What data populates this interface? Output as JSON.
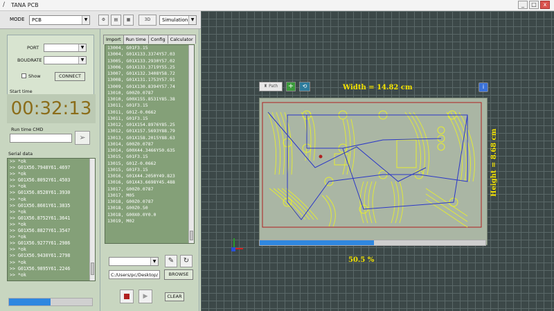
{
  "window": {
    "title": "TANA PCB",
    "controls": [
      "_",
      "□",
      "x"
    ]
  },
  "toolbar": {
    "mode_label": "MODE",
    "mode_value": "PCB",
    "run_mode_value": "Simulation",
    "btn_3d": "3D"
  },
  "connection": {
    "port_label": "PORT",
    "port_value": "",
    "baudrate_label": "BOUDRATE",
    "baudrate_value": "",
    "show_label": "Show",
    "connect_label": "CONNECT"
  },
  "start_time": {
    "label": "Start time",
    "value": "00:32:13"
  },
  "run_time_cmd": {
    "label": "Run time CMD",
    "value": ""
  },
  "serial": {
    "label": "Serial data",
    "lines": [
      ">> *ok",
      ">> G01X56.7948Y61.4697",
      ">> *ok",
      ">> G01X56.8092Y61.4503",
      ">> *ok",
      ">> G01X56.8528Y61.3930",
      ">> *ok",
      ">> G01X56.8601Y61.3835",
      ">> *ok",
      ">> G01X56.8752Y61.3641",
      ">> *ok",
      ">> G01X56.8827Y61.3547",
      ">> *ok",
      ">> G01X56.9277Y61.2986",
      ">> *ok",
      ">> G01X56.9430Y61.2798",
      ">> *ok",
      ">> G01X56.9895Y61.2246",
      ">> *ok"
    ],
    "progress": 0.5
  },
  "tabs": [
    "Import",
    "Run time",
    "Config",
    "Calculator"
  ],
  "gcode": {
    "lines": [
      "13004, G01F3.15",
      "13004, G01X133.3374Y57.03",
      "13005, G01X133.2930Y57.02",
      "13006, G01X133.3719Y55.25",
      "13007, G01X132.3408Y58.72",
      "13008, G01X131.1753Y57.91",
      "13009, G01X130.8394Y57.74",
      "13010, G00Z0.0787",
      "13010, G00X155.8531Y85.38",
      "13011, G01F3.15",
      "13011, G01Z-0.0662",
      "13011, G01F3.15",
      "13012, G01X154.8976Y85.25",
      "13012, G01X157.5693Y88.79",
      "13013, G01X158.2015Y88.63",
      "13014, G00Z0.0787",
      "13014, G00X44.3466Y50.635",
      "13015, G01F3.15",
      "13015, G01Z-0.0662",
      "13015, G01F3.15",
      "13016, G01X44.2050Y49.823",
      "13016, G01X43.6698Y45.488",
      "13017, G00Z0.0787",
      "13017, M05",
      "13018, G00Z0.0787",
      "13018, G00Z0.50",
      "13018, G00X0.0Y0.0",
      "13019, M02"
    ],
    "file_select_value": "",
    "file_path": "C:/Users/pc/Desktop/",
    "browse_label": "BROWSE",
    "clear_label": "CLEAR"
  },
  "viewer": {
    "path_label": "Path",
    "width_text": "Width = 14.82 cm",
    "height_text": "Height = 8.68 cm",
    "progress_text": "50.5 %",
    "progress": 0.505
  },
  "colors": {
    "trace_yellow": "#e6ee30",
    "trace_blue": "#2a36c8",
    "board_red": "#b02020",
    "accent": "#2f87e0"
  }
}
